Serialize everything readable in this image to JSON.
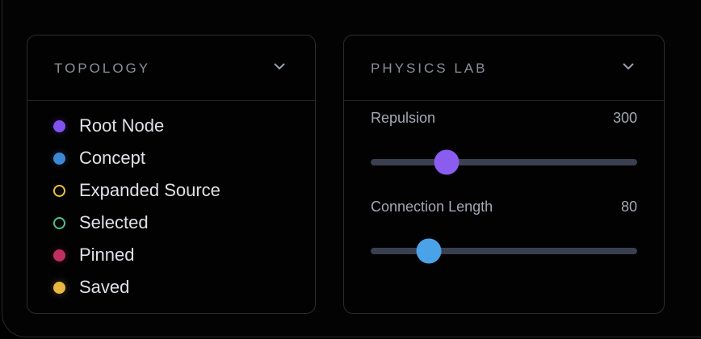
{
  "topology": {
    "title": "TOPOLOGY",
    "items": [
      {
        "label": "Root Node",
        "color": "#8152f0",
        "style": "filled"
      },
      {
        "label": "Concept",
        "color": "#3d88d4",
        "style": "filled"
      },
      {
        "label": "Expanded Source",
        "color": "#f0c040",
        "style": "outline"
      },
      {
        "label": "Selected",
        "color": "#4fc08d",
        "style": "outline"
      },
      {
        "label": "Pinned",
        "color": "#c0305f",
        "style": "filled"
      },
      {
        "label": "Saved",
        "color": "#e8b840",
        "style": "filled"
      }
    ]
  },
  "physics": {
    "title": "PHYSICS LAB",
    "sliders": [
      {
        "label": "Repulsion",
        "value": "300",
        "fraction": 0.286,
        "color": "#8b5cf0"
      },
      {
        "label": "Connection Length",
        "value": "80",
        "fraction": 0.217,
        "color": "#4aa3e8"
      }
    ]
  }
}
